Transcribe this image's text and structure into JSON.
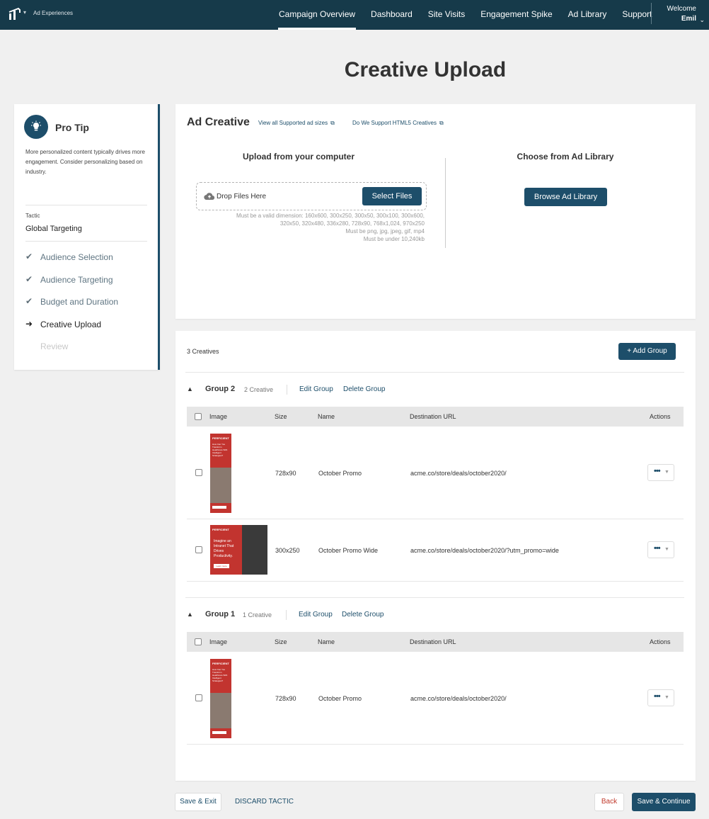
{
  "nav": {
    "brand": "Ad Experiences",
    "links": [
      "Campaign Overview",
      "Dashboard",
      "Site Visits",
      "Engagement Spike",
      "Ad Library",
      "Support"
    ],
    "active_link": "Campaign Overview",
    "welcome": "Welcome",
    "user": "Emil"
  },
  "page": {
    "title": "Creative Upload"
  },
  "sidebar": {
    "tip_title": "Pro Tip",
    "tip_text": "More personalized content typically drives more engagement. Consider personalizing based on industry.",
    "tactic_label": "Tactic",
    "tactic_value": "Global Targeting",
    "steps": [
      {
        "label": "Audience Selection",
        "state": "done"
      },
      {
        "label": "Audience Targeting",
        "state": "done"
      },
      {
        "label": "Budget and Duration",
        "state": "done"
      },
      {
        "label": "Creative Upload",
        "state": "current"
      },
      {
        "label": "Review",
        "state": "disabled"
      }
    ]
  },
  "upload": {
    "title": "Ad Creative",
    "link_sizes": "View all Supported ad sizes",
    "link_html5": "Do We Support HTML5 Creatives",
    "left_title": "Upload from your computer",
    "drop_label": "Drop Files Here",
    "select_files": "Select Files",
    "hints": [
      "Must be a valid dimension: 160x600, 300x250, 300x50, 300x100, 300x600,",
      "320x50, 320x480, 336x280, 728x90, 768x1,024, 970x250",
      "Must be png, jpg, jpeg, gif, mp4",
      "Must be under 10,240kb"
    ],
    "right_title": "Choose from Ad Library",
    "browse_library": "Browse Ad Library"
  },
  "creatives": {
    "count": "3 Creatives",
    "add_group": "+ Add Group",
    "columns": {
      "image": "Image",
      "size": "Size",
      "name": "Name",
      "url": "Destination URL",
      "actions": "Actions"
    },
    "groups": [
      {
        "name": "Group 2",
        "count": "2 Creative",
        "edit": "Edit Group",
        "delete": "Delete Group",
        "rows": [
          {
            "size": "728x90",
            "name": "October Promo",
            "url": "acme.co/store/deals/october2020/",
            "thumb_brand": "PERFICIENT",
            "thumb_text": "How Can You Transform Healthcare With Intelligent Strategies?"
          },
          {
            "size": "300x250",
            "name": "October Promo Wide",
            "url": "acme.co/store/deals/october2020/?utm_promo=wide",
            "thumb_brand": "PERFICIENT",
            "thumb_text": "Imagine an Intranet That Drives Productivity.",
            "thumb_cta": "Learn more"
          }
        ]
      },
      {
        "name": "Group 1",
        "count": "1 Creative",
        "edit": "Edit Group",
        "delete": "Delete Group",
        "rows": [
          {
            "size": "728x90",
            "name": "October Promo",
            "url": "acme.co/store/deals/october2020/",
            "thumb_brand": "PERFICIENT",
            "thumb_text": "How Can You Transform Healthcare With Intelligent Strategies?"
          }
        ]
      }
    ]
  },
  "footer": {
    "save_exit": "Save & Exit",
    "discard": "DISCARD TACTIC",
    "back": "Back",
    "save_continue": "Save & Continue"
  },
  "colors": {
    "navbar": "#163a4a",
    "primary": "#1d4e6a",
    "danger": "#c0392b",
    "thumb_red": "#c2342f"
  },
  "icons": {
    "tip": "lightbulb-icon",
    "check": "check-icon",
    "arrow": "arrow-right-icon",
    "upload": "cloud-upload-icon",
    "external": "external-link-icon",
    "caret": "chevron-up-icon",
    "more": "more-dots-icon"
  }
}
